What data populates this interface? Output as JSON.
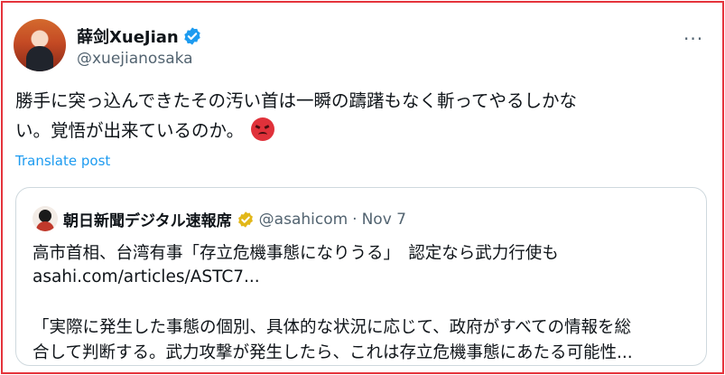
{
  "author": {
    "display_name": "薛剑XueJian",
    "handle": "@xuejianosaka"
  },
  "tweet": {
    "text_line1": "勝手に突っ込んできたその汚い首は一瞬の躊躇もなく斬ってやるしかな",
    "text_line2": "い。覚悟が出来ているのか。",
    "emoji": "angry-face",
    "translate_label": "Translate post",
    "more_label": "···"
  },
  "quote": {
    "display_name": "朝日新聞デジタル速報席",
    "handle": "@asahicom",
    "separator": "·",
    "date": "Nov 7",
    "headline": "高市首相、台湾有事「存立危機事態になりうる」　認定なら武力行使も",
    "link": "asahi.com/articles/ASTC7...",
    "excerpt_line1": "「実際に発生した事態の個別、具体的な状況に応じて、政府がすべての情報を総",
    "excerpt_line2": "合して判断する。武力攻撃が発生したら、これは存立危機事態にあたる可能性..."
  },
  "colors": {
    "link_blue": "#1d9bf0",
    "verified_blue": "#1d9bf0",
    "verified_gold": "#e2b719",
    "frame_red": "#e5333b",
    "secondary_text": "#536471"
  }
}
